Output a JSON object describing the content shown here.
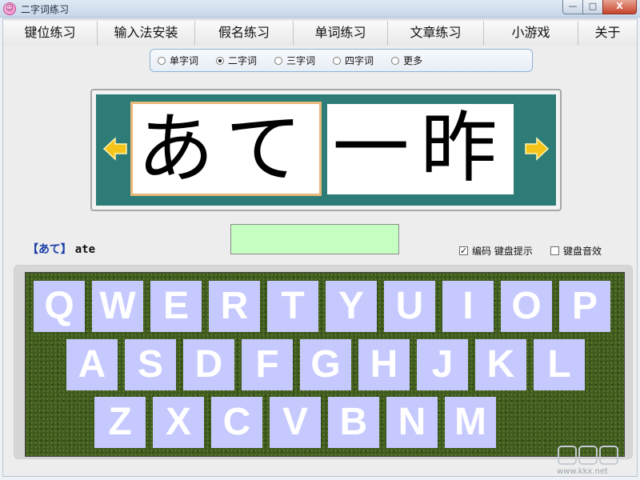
{
  "window": {
    "title": "二字词练习",
    "icon": "smiley-face-icon",
    "controls": {
      "minimize": "—",
      "maximize": "□",
      "close": "X"
    }
  },
  "menu": {
    "items": [
      {
        "label": "键位练习"
      },
      {
        "label": "输入法安装"
      },
      {
        "label": "假名练习"
      },
      {
        "label": "单词练习"
      },
      {
        "label": "文章练习"
      },
      {
        "label": "小游戏"
      },
      {
        "label": "关于"
      }
    ]
  },
  "mode": {
    "options": [
      {
        "label": "单字词",
        "selected": false
      },
      {
        "label": "二字词",
        "selected": true
      },
      {
        "label": "三字词",
        "selected": false
      },
      {
        "label": "四字词",
        "selected": false
      },
      {
        "label": "更多",
        "selected": false
      }
    ]
  },
  "display": {
    "kana": "あて",
    "kanji": "一昨",
    "prev_icon": "left-arrow-icon",
    "next_icon": "right-arrow-icon",
    "background_color": "#2e7c78",
    "arrow_color": "#f5c41b"
  },
  "hint": {
    "kana": "【あて】",
    "romaji": "ate"
  },
  "input": {
    "value": "",
    "background_color": "#c6ffc2"
  },
  "options": {
    "code_keyboard_hint": {
      "label": "编码 键盘提示",
      "checked": true
    },
    "keyboard_sound": {
      "label": "键盘音效",
      "checked": false
    }
  },
  "keyboard": {
    "rows": [
      [
        "Q",
        "W",
        "E",
        "R",
        "T",
        "Y",
        "U",
        "I",
        "O",
        "P"
      ],
      [
        "A",
        "S",
        "D",
        "F",
        "G",
        "H",
        "J",
        "K",
        "L"
      ],
      [
        "Z",
        "X",
        "C",
        "V",
        "B",
        "N",
        "M"
      ]
    ],
    "key_color": "#c6c9fe",
    "board_color": "#3f5a1e"
  },
  "watermark": {
    "url": "www.kkx.net"
  }
}
